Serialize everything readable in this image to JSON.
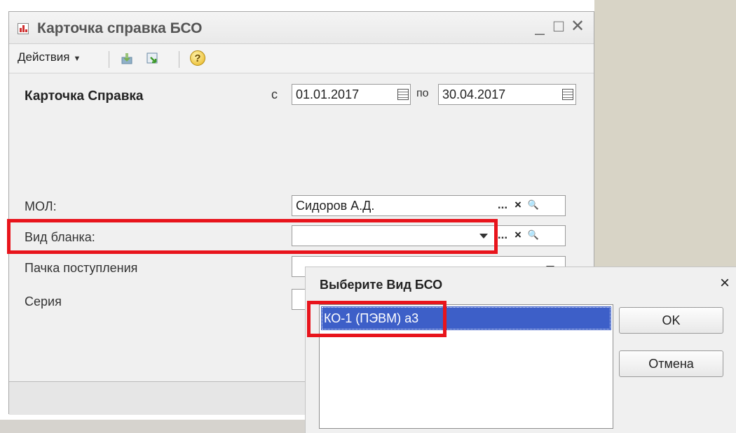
{
  "window": {
    "title": "Карточка справка БСО",
    "controls": {
      "minimize": "_",
      "maximize": "□",
      "close": "✕"
    }
  },
  "toolbar": {
    "actions_label": "Действия",
    "help_label": "?"
  },
  "form": {
    "heading": "Карточка Справка",
    "from_label": "с",
    "from_date": "01.01.2017",
    "to_label": "по",
    "to_date": "30.04.2017",
    "mol_label": "МОЛ:",
    "mol_value": "Сидоров А.Д.",
    "blank_type_label": "Вид бланка:",
    "blank_type_value": "",
    "batch_label": "Пачка поступления",
    "series_label": "Серия",
    "dots": "...",
    "clear": "×",
    "search": "🔍"
  },
  "dialog": {
    "title": "Выберите Вид БСО",
    "close": "×",
    "items": [
      "КО-1 (ПЭВМ)  а3"
    ],
    "ok_label": "OK",
    "cancel_label": "Отмена"
  },
  "colors": {
    "highlight": "#e8141c",
    "selection": "#3d5fc8"
  }
}
